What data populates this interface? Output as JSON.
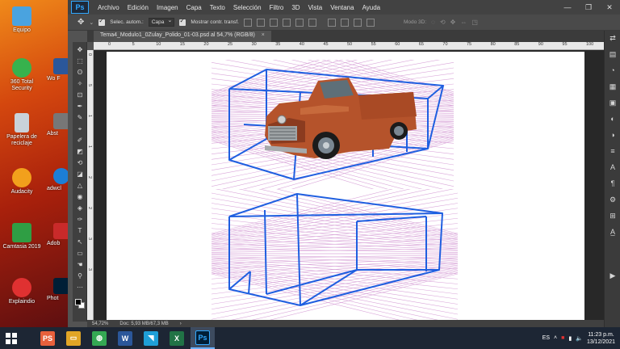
{
  "desktop": {
    "icons": [
      {
        "label": "Equipo",
        "color": "#4aa3df"
      },
      {
        "label": "360 Total Security",
        "color": "#37b24d"
      },
      {
        "label": "Papelera de reciclaje",
        "color": "#c9d1d9"
      },
      {
        "label": "Audacity",
        "color": "#f2a01c"
      },
      {
        "label": "Camtasia 2019",
        "color": "#2f9e44"
      },
      {
        "label": "Explaindio",
        "color": "#e03131"
      }
    ],
    "partial_icons": [
      {
        "label": "Wo F",
        "color": "#2b579a"
      },
      {
        "label": "Abst",
        "color": "#777777"
      },
      {
        "label": "adwcl",
        "color": "#1c7ed6"
      },
      {
        "label": "Adob",
        "color": "#c92a2a"
      },
      {
        "label": "Phot",
        "color": "#001e36"
      }
    ]
  },
  "app": {
    "logo": "Ps",
    "menu": [
      "Archivo",
      "Edición",
      "Imagen",
      "Capa",
      "Texto",
      "Selección",
      "Filtro",
      "3D",
      "Vista",
      "Ventana",
      "Ayuda"
    ],
    "window_controls": [
      "—",
      "❐",
      "✕"
    ],
    "options": {
      "auto_select_label": "Selec. autom.:",
      "auto_select_value": "Capa",
      "show_transform_label": "Mostrar contr. transf.",
      "mode3d_label": "Modo 3D:"
    },
    "document_tab": "Tema4_Modulo1_0Zulay_Polido_01-03.psd al 54,7% (RGB/8)",
    "tab_close": "×",
    "ruler_top_ticks": [
      "0",
      "5",
      "10",
      "15",
      "20",
      "25",
      "30",
      "35",
      "40",
      "45",
      "50",
      "55",
      "60",
      "65",
      "70",
      "75",
      "80",
      "85",
      "90",
      "95",
      "100"
    ],
    "ruler_left_ticks": [
      "0",
      "5",
      "1",
      "1",
      "2",
      "2",
      "3",
      "3"
    ],
    "status": {
      "zoom": "54,72%",
      "doc": "Doc: 5,93 MB/67,3 MB",
      "arrow": "›"
    },
    "tools": [
      "✥",
      "⬚",
      "ʘ",
      "✧",
      "⊡",
      "✒",
      "✎",
      "⌖",
      "✐",
      "◩",
      "⟲",
      "◪",
      "△",
      "◉",
      "◈",
      "✑",
      "T",
      "↖",
      "▭",
      "☚",
      "⚲",
      "⋯"
    ],
    "right_panel_icons": [
      "⇄",
      "▤",
      "◔",
      "▦",
      "▣",
      "◐",
      "◑",
      "≡",
      "A",
      "¶",
      "⚙",
      "⊞",
      "A̲",
      "▶"
    ]
  },
  "taskbar": {
    "apps": [
      {
        "label": "PS",
        "color": "#e8603c"
      },
      {
        "label": "▭",
        "color": "#e0a526"
      },
      {
        "label": "◍",
        "color": "#34a853"
      },
      {
        "label": "W",
        "color": "#2b579a"
      },
      {
        "label": "◥",
        "color": "#1f9fd7"
      },
      {
        "label": "X",
        "color": "#217346"
      },
      {
        "label": "Ps",
        "color": "#001e36"
      }
    ],
    "lang": "ES",
    "time": "11:23 p.m.",
    "date": "13/12/2021"
  },
  "colors": {
    "accent": "#31a8ff",
    "perspective_lines": "#1f5fe0",
    "grid_lines": "#d9a6d9"
  }
}
